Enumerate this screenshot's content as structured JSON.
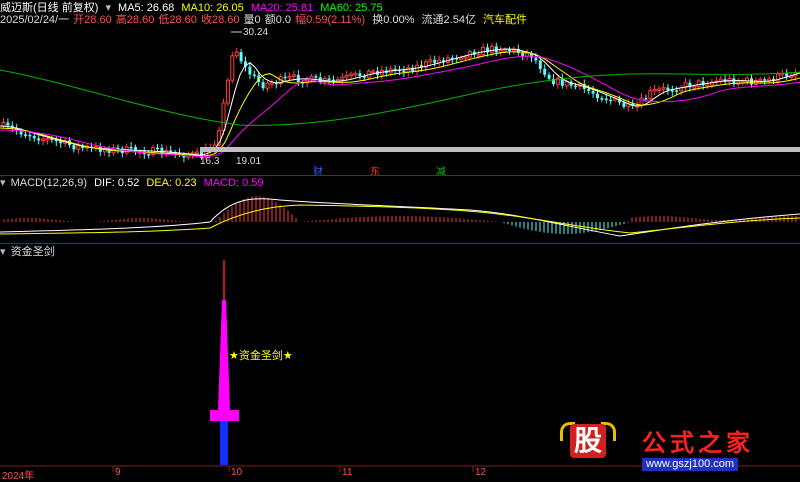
{
  "header": {
    "stock_name": "威迈斯(日线 前复权)",
    "ma": [
      {
        "label": "MA5: 26.68",
        "color": "#ffffff"
      },
      {
        "label": "MA10: 26.05",
        "color": "#ffff00"
      },
      {
        "label": "MA20: 25.81",
        "color": "#ff00ff"
      },
      {
        "label": "MA60: 25.75",
        "color": "#00ff00"
      }
    ],
    "date": "2025/02/24/一",
    "open": "开28.60",
    "high": "高28.60",
    "low": "低28.60",
    "close": "收28.60",
    "volume": "量0",
    "amount": "额0.0",
    "change": "幅0.59(2.11%)",
    "turnover": "换0.00%",
    "float_cap": "流通2.54亿",
    "industry": "汽车配件"
  },
  "price_panel": {
    "high_marker": "30.24",
    "low_marker_a": "16.3",
    "low_marker_b": "19.01",
    "event_tags": [
      {
        "text": "财",
        "color": "#3060ff"
      },
      {
        "text": "东",
        "color": "#ff3030"
      },
      {
        "text": "减",
        "color": "#00c000"
      }
    ]
  },
  "macd_panel": {
    "title": "MACD(12,26,9)",
    "dif": "DIF: 0.52",
    "dea": "DEA: 0.23",
    "macd": "MACD: 0.59"
  },
  "indicator_panel": {
    "title": "资金圣剑",
    "sword_label": "★资金圣剑★"
  },
  "time_axis": {
    "labels": [
      "2024年",
      "9",
      "10",
      "11",
      "12"
    ]
  },
  "watermark": {
    "logo_char": "股",
    "site_name": "公式之家",
    "url": "www.gszj100.com"
  },
  "colors": {
    "up": "#ff3c3c",
    "down": "#54ffff",
    "ma5": "#ffffff",
    "ma10": "#ffff00",
    "ma20": "#ff00ff",
    "ma60": "#00ff00",
    "sword_top": "#c01020",
    "sword_body": "#ff00ff",
    "sword_bottom": "#1030ff"
  }
}
